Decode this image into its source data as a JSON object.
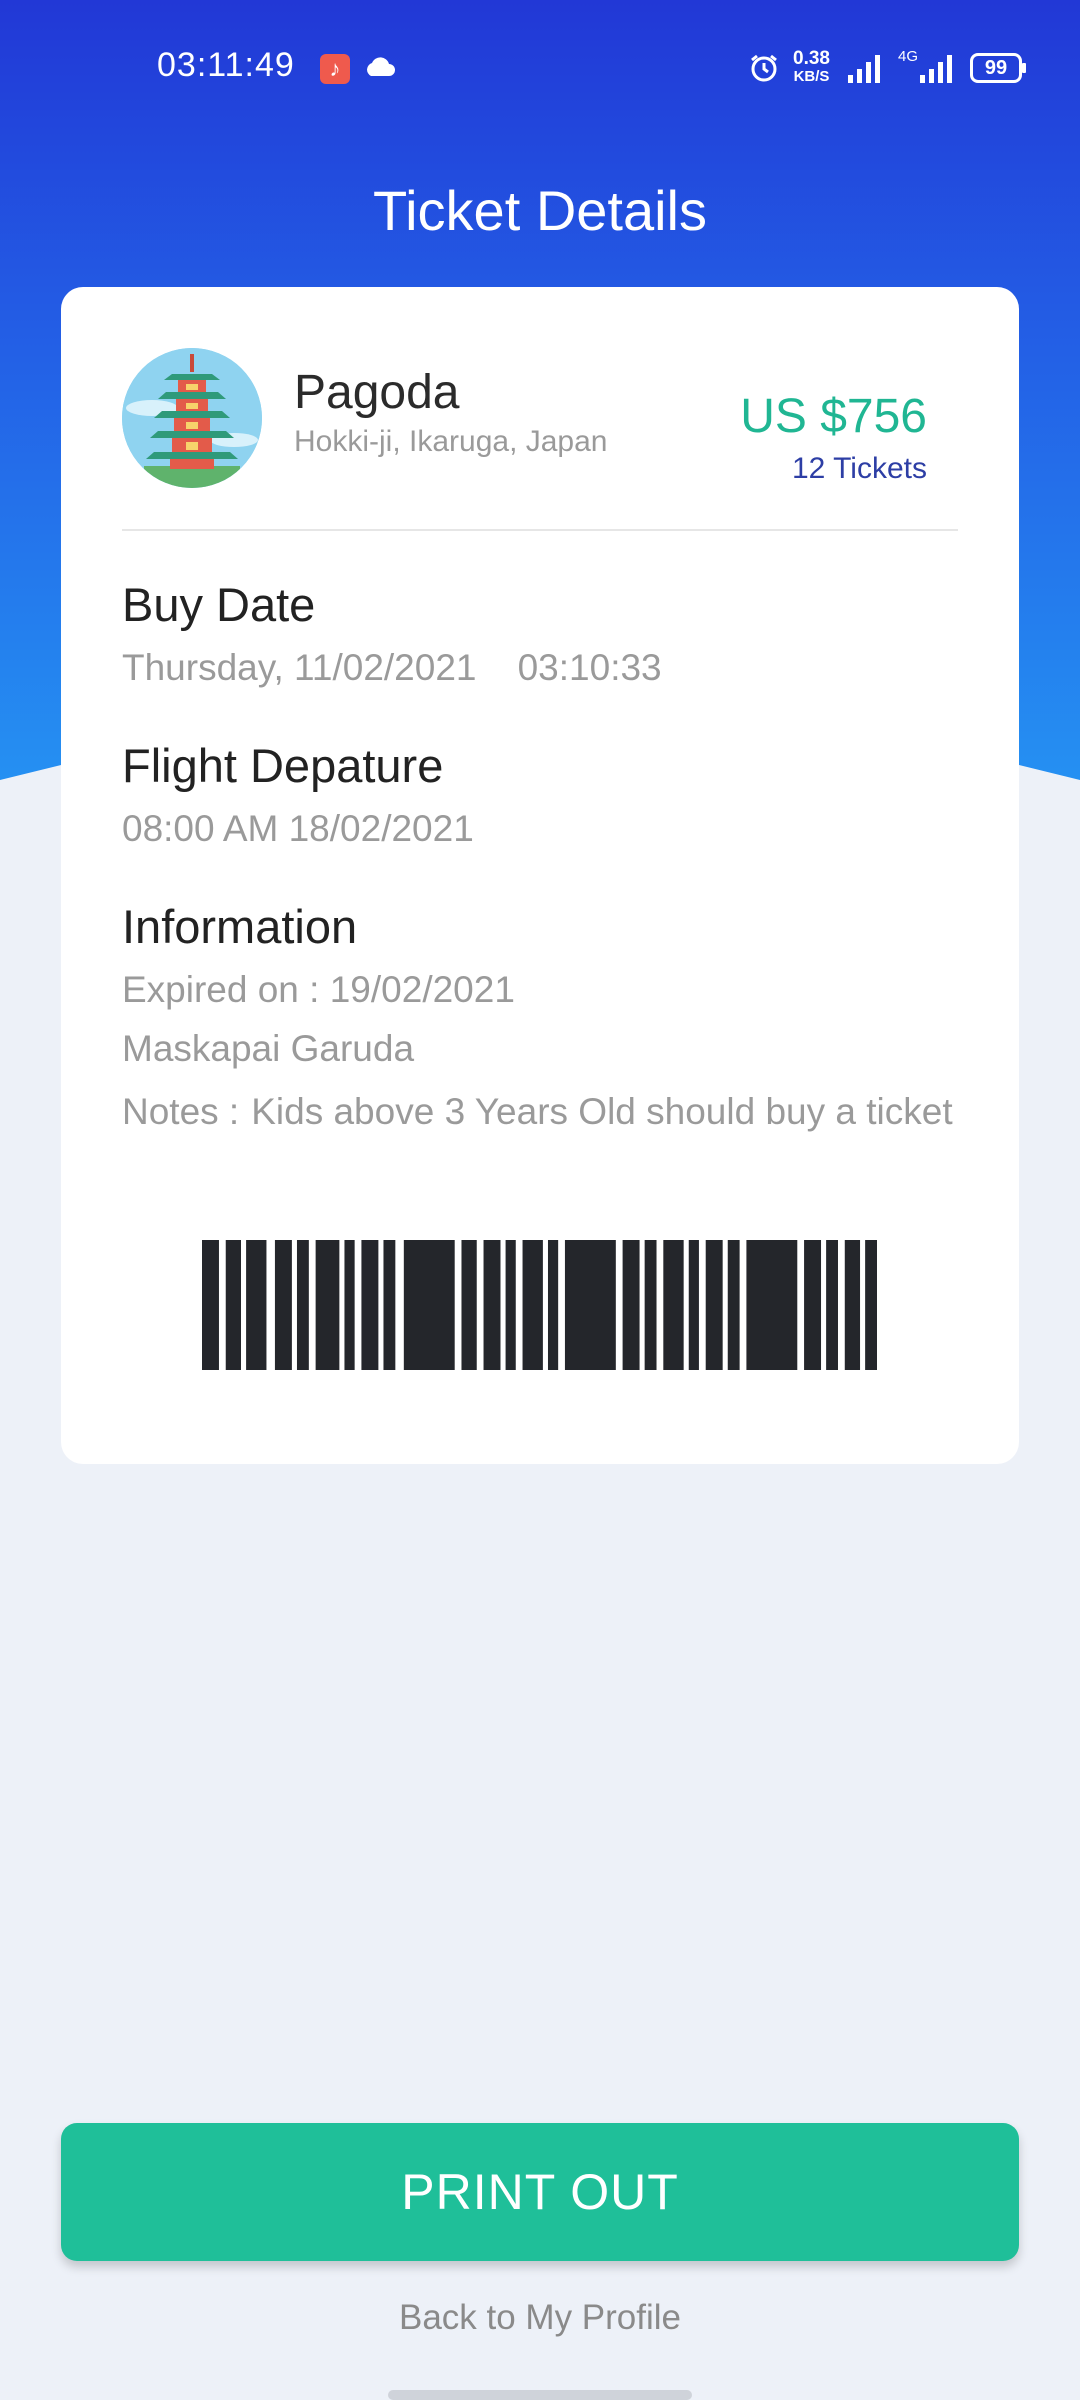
{
  "status_bar": {
    "time": "03:11:49",
    "net_speed_value": "0.38",
    "net_speed_unit": "KB/S",
    "network_type": "4G",
    "battery_level": "99"
  },
  "header": {
    "title": "Ticket Details"
  },
  "ticket": {
    "place_name": "Pagoda",
    "place_location": "Hokki-ji, Ikaruga, Japan",
    "price": "US $756",
    "ticket_count": "12 Tickets",
    "buy_date_label": "Buy Date",
    "buy_date_value": "Thursday, 11/02/2021    03:10:33",
    "flight_label": "Flight Depature",
    "flight_value": "08:00 AM 18/02/2021",
    "info_label": "Information",
    "expired_on": "Expired on : 19/02/2021",
    "airline": "Maskapai Garuda",
    "notes_label": "Notes :",
    "notes_value": "Kids above 3 Years Old should buy a ticket"
  },
  "actions": {
    "print_label": "PRINT OUT",
    "back_label": "Back to My Profile"
  },
  "colors": {
    "header_gradient_top": "#2238d6",
    "header_gradient_bottom": "#2590f2",
    "price_green": "#20b693",
    "ticket_count_blue": "#2d3ea5",
    "button_green": "#1fbf99",
    "page_background": "#edf1f8"
  },
  "icons": [
    "music-app-icon",
    "cloud-icon",
    "alarm-icon",
    "cellular-signal-icon",
    "battery-icon",
    "pagoda-icon",
    "barcode"
  ]
}
